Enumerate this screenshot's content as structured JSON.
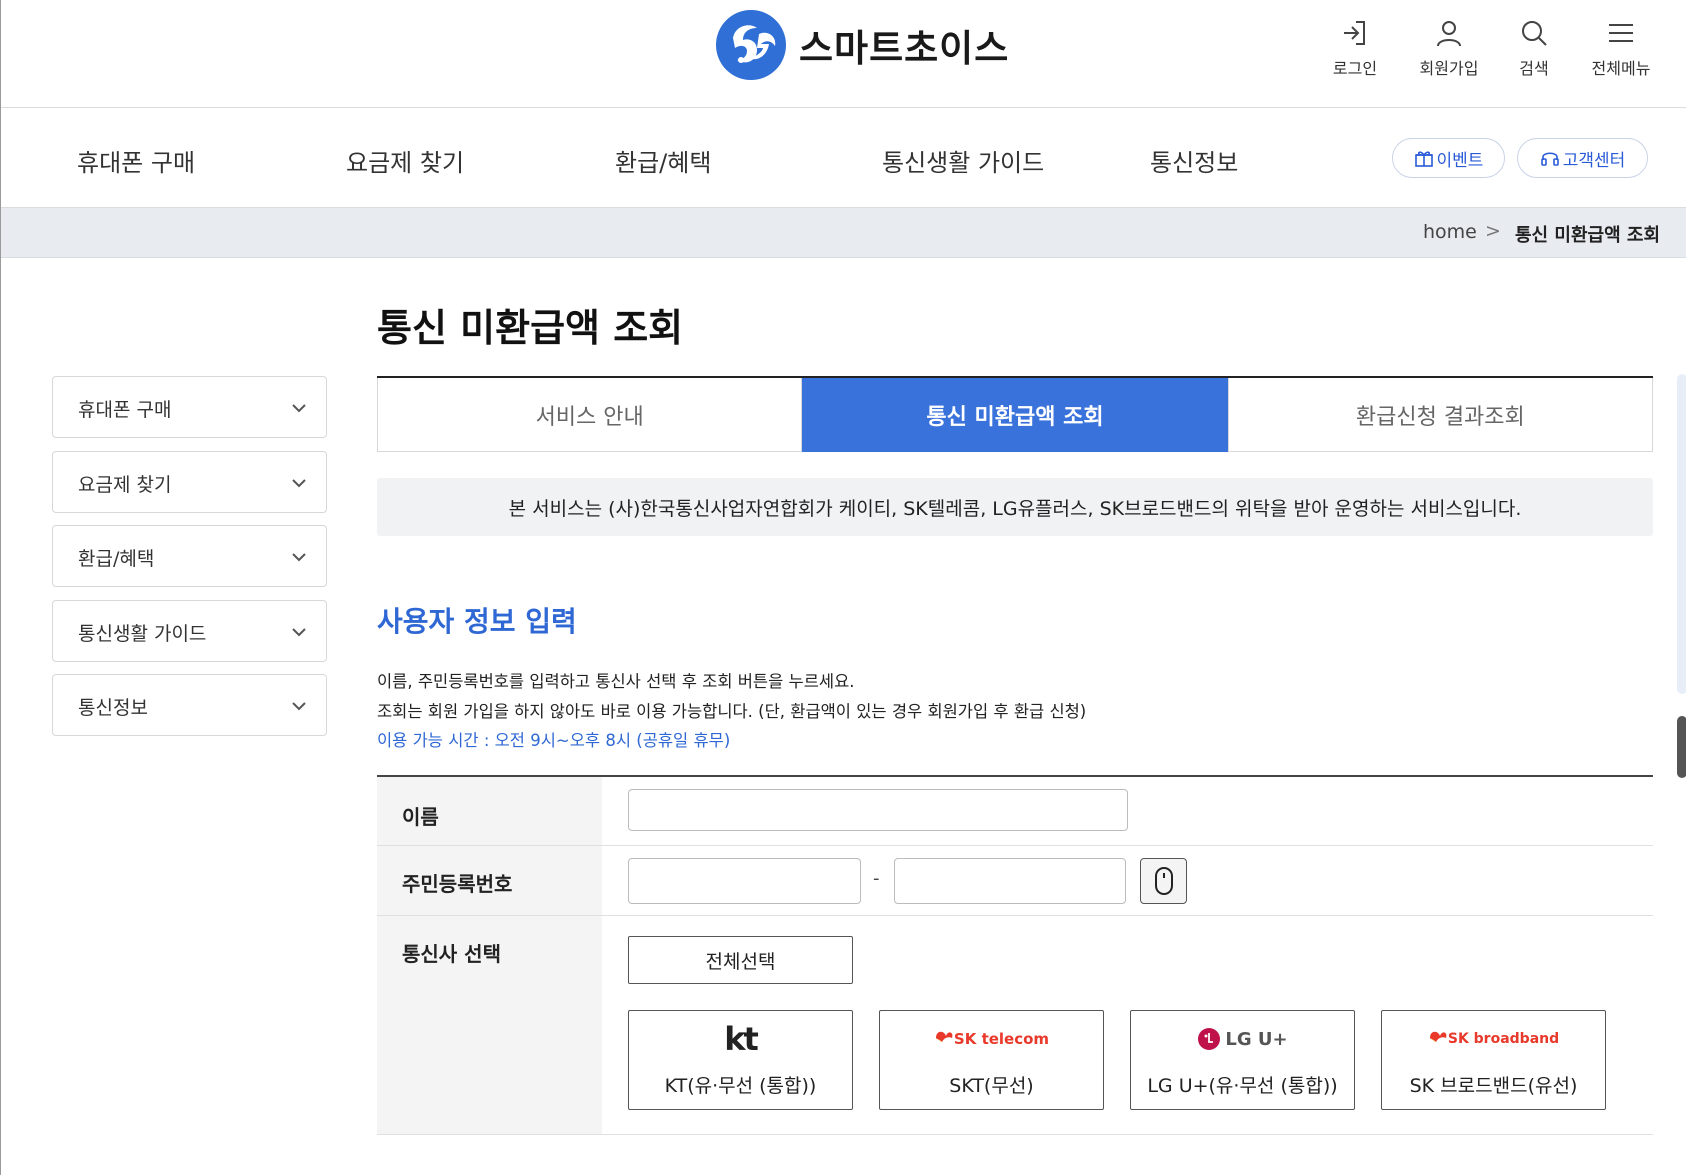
{
  "header": {
    "logo_text": "스마트초이스",
    "utils": [
      {
        "label": "로그인",
        "icon": "login-icon"
      },
      {
        "label": "회원가입",
        "icon": "user-icon"
      },
      {
        "label": "검색",
        "icon": "search-icon"
      },
      {
        "label": "전체메뉴",
        "icon": "menu-icon"
      }
    ]
  },
  "nav": {
    "items": [
      "휴대폰 구매",
      "요금제 찾기",
      "환급/혜택",
      "통신생활 가이드",
      "통신정보"
    ],
    "event_label": "이벤트",
    "support_label": "고객센터"
  },
  "breadcrumb": {
    "home": "home",
    "separator": ">",
    "current": "통신 미환급액 조회"
  },
  "sidebar": {
    "items": [
      {
        "label": "휴대폰 구매"
      },
      {
        "label": "요금제 찾기"
      },
      {
        "label": "환급/혜택"
      },
      {
        "label": "통신생활 가이드"
      },
      {
        "label": "통신정보"
      }
    ]
  },
  "main": {
    "title": "통신 미환급액 조회",
    "tabs": [
      {
        "label": "서비스 안내",
        "active": false
      },
      {
        "label": "통신 미환급액 조회",
        "active": true
      },
      {
        "label": "환급신청 결과조회",
        "active": false
      }
    ],
    "notice": "본 서비스는 (사)한국통신사업자연합회가 케이티, SK텔레콤, LG유플러스, SK브로드밴드의 위탁을 받아 운영하는 서비스입니다.",
    "section_title": "사용자 정보 입력",
    "desc_lines": [
      "이름, 주민등록번호를 입력하고 통신사 선택 후 조회 버튼을 누르세요.",
      "조회는 회원 가입을 하지 않아도 바로 이용 가능합니다. (단, 환급액이 있는 경우 회원가입 후 환급 신청)"
    ],
    "hours": "이용 가능 시간 : 오전 9시~오후 8시 (공휴일 휴무)"
  },
  "form": {
    "name_label": "이름",
    "name_value": "",
    "rrn_label": "주민등록번호",
    "rrn_front_value": "",
    "rrn_back_value": "",
    "rrn_separator": "-",
    "carrier_label": "통신사 선택",
    "select_all_label": "전체선택",
    "carriers": [
      {
        "name": "KT(유·무선 (통합))",
        "logo_text": "kt"
      },
      {
        "name": "SKT(무선)",
        "logo_text": "SK telecom"
      },
      {
        "name": "LG U+(유·무선 (통합))",
        "logo_text": "LG U+"
      },
      {
        "name": "SK 브로드밴드(유선)",
        "logo_text": "SK broadband"
      }
    ]
  },
  "colors": {
    "accent": "#3a72dc",
    "link": "#2f68d4",
    "breadcrumb_bg": "#e8ebef"
  }
}
